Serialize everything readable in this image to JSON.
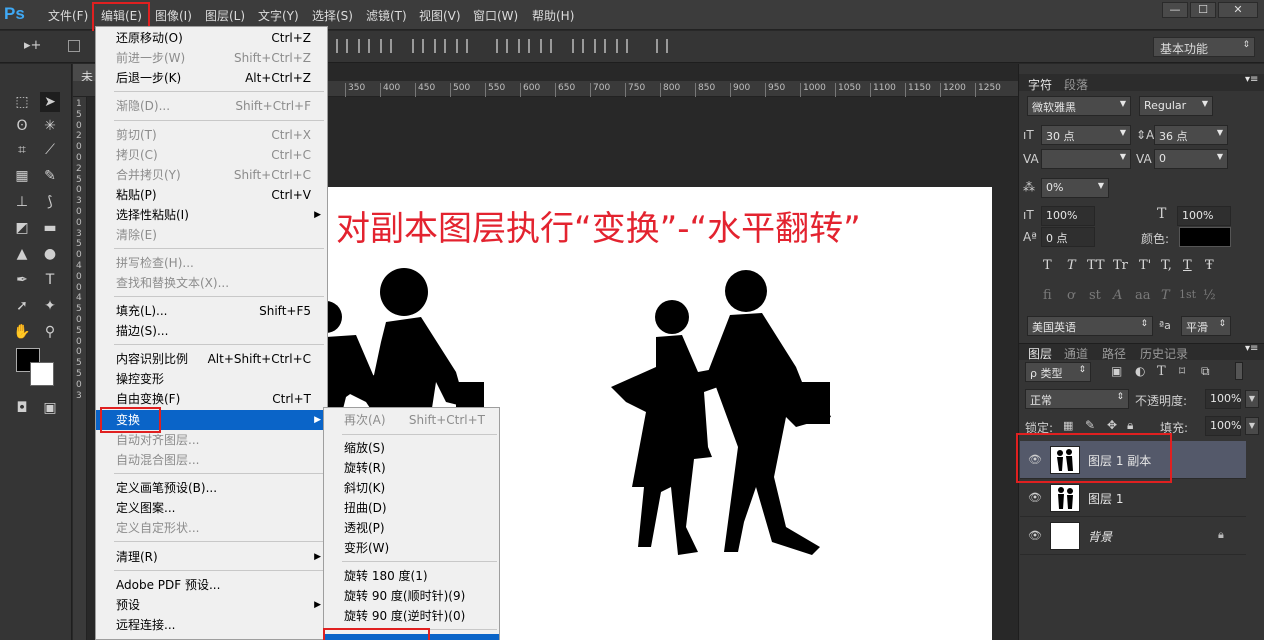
{
  "app": {
    "logo": "Ps"
  },
  "menubar": {
    "items": [
      "文件(F)",
      "编辑(E)",
      "图像(I)",
      "图层(L)",
      "文字(Y)",
      "选择(S)",
      "滤镜(T)",
      "视图(V)",
      "窗口(W)",
      "帮助(H)"
    ],
    "window_buttons": [
      "—",
      "☐",
      "✕"
    ]
  },
  "options_bar": {
    "workspace": "基本功能"
  },
  "document": {
    "tab_label": "未",
    "ruler_ticks": [
      "350",
      "400",
      "450",
      "500",
      "550",
      "600",
      "650",
      "700",
      "750",
      "800",
      "850",
      "900",
      "950",
      "1000",
      "1050",
      "1100",
      "1150",
      "1200",
      "1250"
    ],
    "left_ruler_digits": [
      "1",
      "5",
      "0",
      "2",
      "0",
      "0",
      "2",
      "5",
      "0",
      "3",
      "0",
      "0",
      "3",
      "5",
      "0",
      "4",
      "0",
      "0",
      "4",
      "5",
      "0",
      "5",
      "0",
      "0",
      "5",
      "5",
      "0",
      "3"
    ],
    "canvas_title": "对副本图层执行“变换”-“水平翻转”"
  },
  "edit_menu": {
    "items": [
      {
        "label": "还原移动(O)",
        "shortcut": "Ctrl+Z",
        "disabled": false
      },
      {
        "label": "前进一步(W)",
        "shortcut": "Shift+Ctrl+Z",
        "disabled": true
      },
      {
        "label": "后退一步(K)",
        "shortcut": "Alt+Ctrl+Z",
        "disabled": false
      },
      {
        "label": "渐隐(D)...",
        "shortcut": "Shift+Ctrl+F",
        "disabled": true
      },
      {
        "label": "剪切(T)",
        "shortcut": "Ctrl+X",
        "disabled": true
      },
      {
        "label": "拷贝(C)",
        "shortcut": "Ctrl+C",
        "disabled": true
      },
      {
        "label": "合并拷贝(Y)",
        "shortcut": "Shift+Ctrl+C",
        "disabled": true
      },
      {
        "label": "粘贴(P)",
        "shortcut": "Ctrl+V",
        "disabled": false
      },
      {
        "label": "选择性粘贴(I)",
        "shortcut": "",
        "disabled": false
      },
      {
        "label": "清除(E)",
        "shortcut": "",
        "disabled": true
      },
      {
        "label": "拼写检查(H)...",
        "shortcut": "",
        "disabled": true
      },
      {
        "label": "查找和替换文本(X)...",
        "shortcut": "",
        "disabled": true
      },
      {
        "label": "填充(L)...",
        "shortcut": "Shift+F5",
        "disabled": false
      },
      {
        "label": "描边(S)...",
        "shortcut": "",
        "disabled": false
      },
      {
        "label": "内容识别比例",
        "shortcut": "Alt+Shift+Ctrl+C",
        "disabled": false
      },
      {
        "label": "操控变形",
        "shortcut": "",
        "disabled": false
      },
      {
        "label": "自由变换(F)",
        "shortcut": "Ctrl+T",
        "disabled": false
      },
      {
        "label": "变换",
        "shortcut": "",
        "disabled": false
      },
      {
        "label": "自动对齐图层...",
        "shortcut": "",
        "disabled": true
      },
      {
        "label": "自动混合图层...",
        "shortcut": "",
        "disabled": true
      },
      {
        "label": "定义画笔预设(B)...",
        "shortcut": "",
        "disabled": false
      },
      {
        "label": "定义图案...",
        "shortcut": "",
        "disabled": false
      },
      {
        "label": "定义自定形状...",
        "shortcut": "",
        "disabled": true
      },
      {
        "label": "清理(R)",
        "shortcut": "",
        "disabled": false
      },
      {
        "label": "Adobe PDF 预设...",
        "shortcut": "",
        "disabled": false
      },
      {
        "label": "预设",
        "shortcut": "",
        "disabled": false
      },
      {
        "label": "远程连接...",
        "shortcut": "",
        "disabled": false
      }
    ]
  },
  "transform_submenu": {
    "items": [
      {
        "label": "再次(A)",
        "shortcut": "Shift+Ctrl+T",
        "disabled": true
      },
      {
        "label": "缩放(S)",
        "shortcut": "",
        "disabled": false
      },
      {
        "label": "旋转(R)",
        "shortcut": "",
        "disabled": false
      },
      {
        "label": "斜切(K)",
        "shortcut": "",
        "disabled": false
      },
      {
        "label": "扭曲(D)",
        "shortcut": "",
        "disabled": false
      },
      {
        "label": "透视(P)",
        "shortcut": "",
        "disabled": false
      },
      {
        "label": "变形(W)",
        "shortcut": "",
        "disabled": false
      },
      {
        "label": "旋转 180 度(1)",
        "shortcut": "",
        "disabled": false
      },
      {
        "label": "旋转 90 度(顺时针)(9)",
        "shortcut": "",
        "disabled": false
      },
      {
        "label": "旋转 90 度(逆时针)(0)",
        "shortcut": "",
        "disabled": false
      }
    ]
  },
  "character_panel": {
    "tabs": [
      "字符",
      "段落"
    ],
    "font_family": "微软雅黑",
    "font_style": "Regular",
    "font_size": "30 点",
    "leading": "36 点",
    "kerning": "",
    "tracking": "0",
    "tsume": "0%",
    "vertical_scale": "100%",
    "horizontal_scale": "100%",
    "baseline_shift": "0 点",
    "color_label": "颜色:",
    "color": "#000000",
    "glyph_row1": [
      "T",
      "T",
      "TT",
      "Tr",
      "T'",
      "T,",
      "T",
      "Ŧ"
    ],
    "glyph_row2": [
      "fi",
      "ơ",
      "st",
      "A",
      "aa",
      "T",
      "1st",
      "½"
    ],
    "language": "美国英语",
    "aa_label": "ªa",
    "antialias": "平滑"
  },
  "layers_panel": {
    "tabs": [
      "图层",
      "通道",
      "路径",
      "历史记录"
    ],
    "filter_kind": "ρ 类型",
    "blend_mode": "正常",
    "opacity_label": "不透明度:",
    "opacity": "100%",
    "lock_label": "锁定:",
    "fill_label": "填充:",
    "fill": "100%",
    "layers": [
      {
        "name": "图层 1 副本",
        "selected": true
      },
      {
        "name": "图层 1",
        "selected": false
      },
      {
        "name": "背景",
        "selected": false
      }
    ]
  },
  "colors": {
    "highlight": "#0a64c8",
    "title_red": "#e3232f",
    "ps_blue": "#3fa9f5"
  }
}
